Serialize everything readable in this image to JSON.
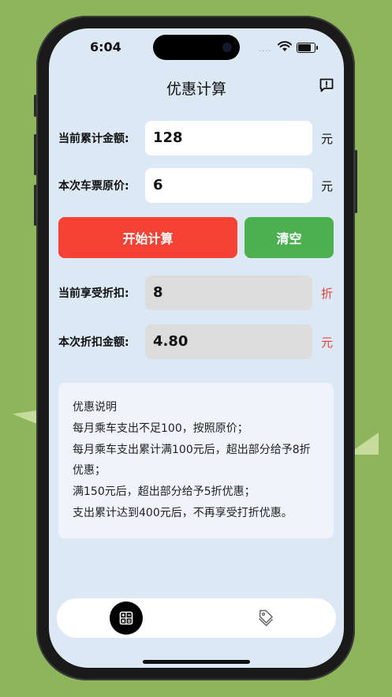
{
  "status": {
    "time": "6:04",
    "signal_dots": "····"
  },
  "nav": {
    "title": "优惠计算"
  },
  "form": {
    "total_label": "当前累计金额:",
    "total_value": "128",
    "total_unit": "元",
    "price_label": "本次车票原价:",
    "price_value": "6",
    "price_unit": "元"
  },
  "actions": {
    "calc_label": "开始计算",
    "clear_label": "清空"
  },
  "result": {
    "discount_label": "当前享受折扣:",
    "discount_value": "8",
    "discount_unit": "折",
    "amount_label": "本次折扣金额:",
    "amount_value": "4.80",
    "amount_unit": "元"
  },
  "info": {
    "lines": [
      "优惠说明",
      "每月乘车支出不足100，按照原价；",
      "每月乘车支出累计满100元后，超出部分给予8折优惠；",
      "满150元后，超出部分给予5折优惠；",
      "支出累计达到400元后，不再享受打折优惠。"
    ]
  },
  "tabs": [
    {
      "icon": "calculator-icon",
      "active": true
    },
    {
      "icon": "tag-icon",
      "active": false
    }
  ],
  "colors": {
    "accent_red": "#f44236",
    "accent_green": "#4caf50",
    "unit_red": "#e0443b",
    "screen_bg": "#dce8f4",
    "page_bg": "#8db65a"
  }
}
